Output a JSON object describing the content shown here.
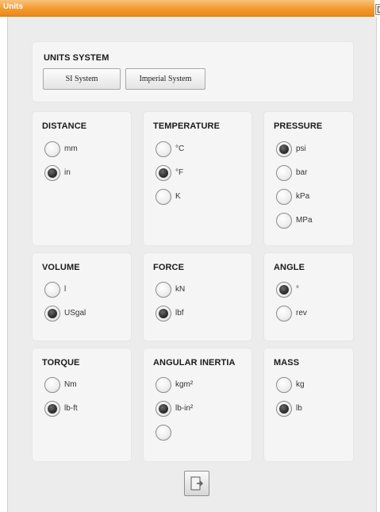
{
  "window": {
    "title": "Units"
  },
  "units_system": {
    "heading": "UNITS SYSTEM",
    "si_label": "SI System",
    "imperial_label": "Imperial System"
  },
  "groups": [
    {
      "key": "distance",
      "heading": "DISTANCE",
      "options": [
        {
          "label": "mm",
          "checked": false
        },
        {
          "label": "in",
          "checked": true
        }
      ]
    },
    {
      "key": "temperature",
      "heading": "TEMPERATURE",
      "options": [
        {
          "label": "°C",
          "checked": false
        },
        {
          "label": "°F",
          "checked": true
        },
        {
          "label": "K",
          "checked": false
        }
      ]
    },
    {
      "key": "pressure",
      "heading": "PRESSURE",
      "options": [
        {
          "label": "psi",
          "checked": true
        },
        {
          "label": "bar",
          "checked": false
        },
        {
          "label": "kPa",
          "checked": false
        },
        {
          "label": "MPa",
          "checked": false
        }
      ]
    },
    {
      "key": "volume",
      "heading": "VOLUME",
      "options": [
        {
          "label": "l",
          "checked": false
        },
        {
          "label": "USgal",
          "checked": true
        }
      ]
    },
    {
      "key": "force",
      "heading": "FORCE",
      "options": [
        {
          "label": "kN",
          "checked": false
        },
        {
          "label": "lbf",
          "checked": true
        }
      ]
    },
    {
      "key": "angle",
      "heading": "ANGLE",
      "options": [
        {
          "label": "°",
          "checked": true
        },
        {
          "label": "rev",
          "checked": false
        }
      ]
    },
    {
      "key": "torque",
      "heading": "TORQUE",
      "options": [
        {
          "label": "Nm",
          "checked": false
        },
        {
          "label": "lb-ft",
          "checked": true
        }
      ]
    },
    {
      "key": "angular_inertia",
      "heading": "ANGULAR INERTIA",
      "options": [
        {
          "label": "kgm²",
          "checked": false
        },
        {
          "label": "lb-in²",
          "checked": true
        },
        {
          "label": "",
          "checked": false
        }
      ]
    },
    {
      "key": "mass",
      "heading": "MASS",
      "options": [
        {
          "label": "kg",
          "checked": false
        },
        {
          "label": "lb",
          "checked": true
        }
      ]
    }
  ],
  "footer": {
    "exit_icon": "exit-door-icon"
  },
  "colors": {
    "titlebar": "#f39a2e",
    "background": "#ececec",
    "panel": "#f5f5f5"
  }
}
